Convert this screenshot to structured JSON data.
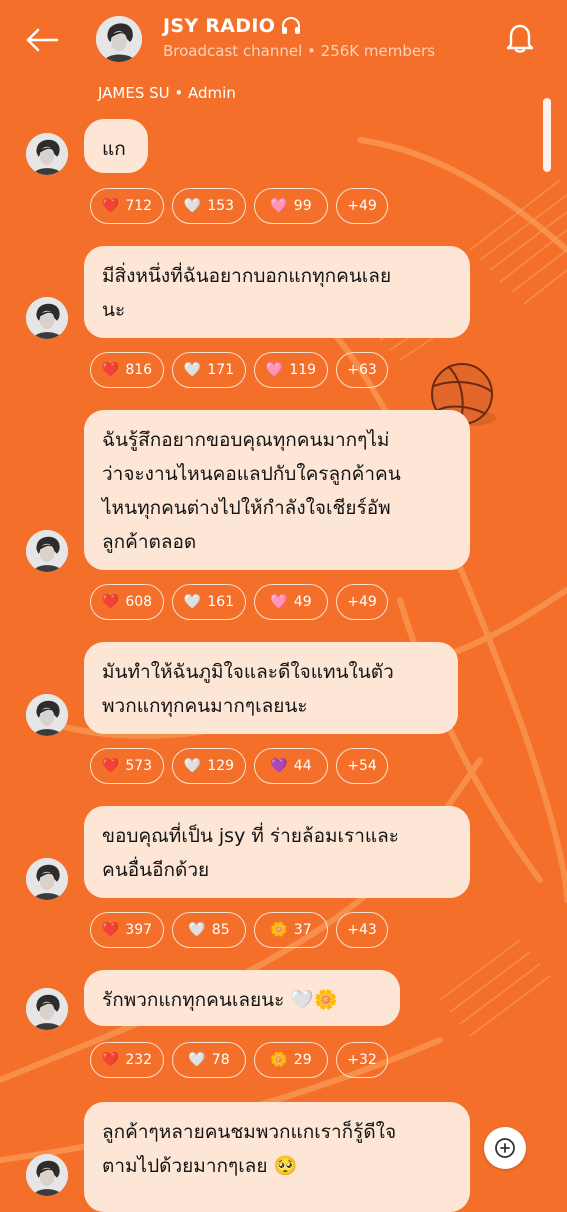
{
  "header": {
    "title": "JSY RADIO",
    "title_icon": "headphones-icon",
    "subtitle": "Broadcast channel • 256K members"
  },
  "sender": "JAMES SU • Admin",
  "messages": [
    {
      "lines": [
        "แก"
      ],
      "reactions": [
        {
          "emoji": "❤️",
          "count": "712"
        },
        {
          "emoji": "🤍",
          "count": "153"
        },
        {
          "emoji": "🩷",
          "count": "99"
        },
        {
          "count": "+49"
        }
      ]
    },
    {
      "lines": [
        "มีสิ่งหนึ่งที่ฉันอยากบอกแกทุกคนเลย",
        "นะ"
      ],
      "reactions": [
        {
          "emoji": "❤️",
          "count": "816"
        },
        {
          "emoji": "🤍",
          "count": "171"
        },
        {
          "emoji": "🩷",
          "count": "119"
        },
        {
          "count": "+63"
        }
      ]
    },
    {
      "lines": [
        "ฉันรู้สึกอยากขอบคุณทุกคนมากๆไม่",
        "ว่าจะงานไหนคอแลปกับใครลูกค้าคน",
        "ไหนทุกคนต่างไปให้กำลังใจเชียร์อัพ",
        "ลูกค้าตลอด"
      ],
      "reactions": [
        {
          "emoji": "❤️",
          "count": "608"
        },
        {
          "emoji": "🤍",
          "count": "161"
        },
        {
          "emoji": "🩷",
          "count": "49"
        },
        {
          "count": "+49"
        }
      ]
    },
    {
      "lines": [
        "มันทำให้ฉันภูมิใจและดีใจแทนในตัว",
        "พวกแกทุกคนมากๆเลยนะ"
      ],
      "reactions": [
        {
          "emoji": "❤️",
          "count": "573"
        },
        {
          "emoji": "🤍",
          "count": "129"
        },
        {
          "emoji": "💜",
          "count": "44"
        },
        {
          "count": "+54"
        }
      ]
    },
    {
      "lines": [
        "ขอบคุณที่เป็น jsy ที่ ร่ายล้อมเราและ",
        "คนอื่นอีกด้วย"
      ],
      "reactions": [
        {
          "emoji": "❤️",
          "count": "397"
        },
        {
          "emoji": "🤍",
          "count": "85"
        },
        {
          "emoji": "🌼",
          "count": "37"
        },
        {
          "count": "+43"
        }
      ]
    },
    {
      "lines": [
        "รักพวกแกทุกคนเลยนะ 🤍🌼"
      ],
      "reactions": [
        {
          "emoji": "❤️",
          "count": "232"
        },
        {
          "emoji": "🤍",
          "count": "78"
        },
        {
          "emoji": "🌼",
          "count": "29"
        },
        {
          "count": "+32"
        }
      ]
    },
    {
      "lines": [
        "ลูกค้าๆหลายคนชมพวกแกเราก็รู้ดีใจ",
        "ตามไปด้วยมากๆเลย 🥺"
      ],
      "reactions": []
    }
  ],
  "colors": {
    "background": "#F4702A",
    "bubble": "#FDE6D6",
    "text": "#141414",
    "subtitle": "#FCD2B8"
  }
}
